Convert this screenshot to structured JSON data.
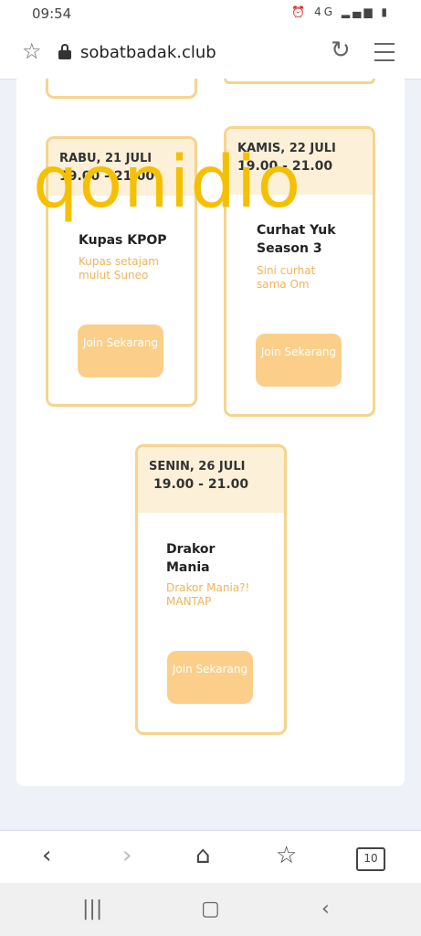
{
  "status": {
    "time": "09:54",
    "icons": "⏰ 4G ▂▄▆ ▮"
  },
  "browser": {
    "url": "sobatbadak.club"
  },
  "cards": [
    {
      "date": "RABU, 21 JULI",
      "time": "19.00 - 21.00",
      "title": "Kupas KPOP",
      "desc": "Kupas setajam mulut Suneo",
      "button": "Join Sekarang"
    },
    {
      "date": "KAMIS, 22 JULI",
      "time": "19.00 - 21.00",
      "title": "Curhat Yuk Season 3",
      "desc": "Sini curhat sama Om",
      "button": "Join Sekarang"
    },
    {
      "date": "SENIN, 26 JULI",
      "time": "19.00 - 21.00",
      "title": "Drakor Mania",
      "desc": "Drakor Mania?! MANTAP",
      "button": "Join Sekarang"
    }
  ],
  "watermark": "qonidio",
  "bottom_nav": {
    "tabs_count": "10"
  },
  "icons": {
    "bookmark": "star-icon",
    "reload": "reload-icon",
    "menu": "menu-icon",
    "back": "back-icon",
    "forward": "forward-icon",
    "home": "home-icon",
    "bookmarks": "bookmarks-icon",
    "tabs": "tabs-icon"
  },
  "colors": {
    "card_border": "#f5d48c",
    "card_header": "#fdf0d8",
    "desc": "#f0b45a",
    "button": "#fbcf8a",
    "watermark": "#f5c000"
  }
}
